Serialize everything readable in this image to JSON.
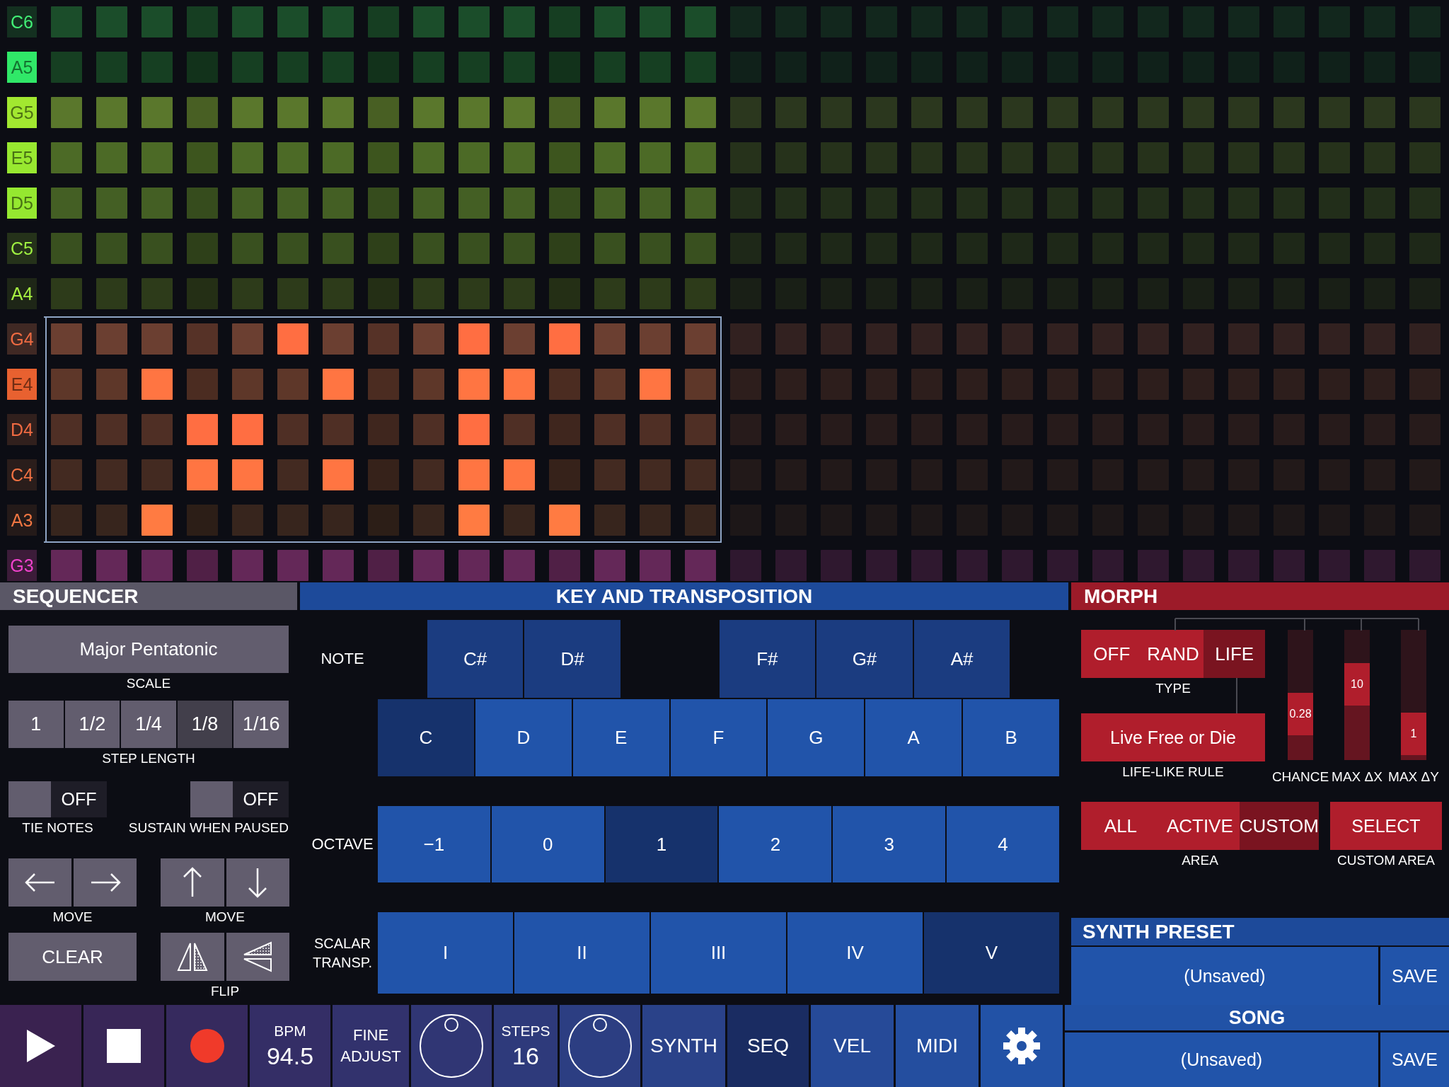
{
  "grid": {
    "rows": [
      {
        "label": "C6",
        "color": "#1b4d2a",
        "lit": false,
        "selected": false,
        "on": [
          false,
          false,
          false,
          false,
          false,
          false,
          false,
          false,
          false,
          false,
          false,
          false,
          false,
          false,
          false
        ]
      },
      {
        "label": "A5",
        "color": "#163f22",
        "lit": true,
        "selected": false,
        "on": [
          false,
          false,
          false,
          false,
          false,
          false,
          false,
          false,
          false,
          false,
          false,
          false,
          false,
          false,
          false
        ]
      },
      {
        "label": "G5",
        "color": "#5a772c",
        "lit": true,
        "selected": false,
        "on": [
          false,
          false,
          false,
          false,
          false,
          false,
          false,
          false,
          false,
          false,
          false,
          false,
          false,
          false,
          false
        ]
      },
      {
        "label": "E5",
        "color": "#4c6a26",
        "lit": true,
        "selected": false,
        "on": [
          false,
          false,
          false,
          false,
          false,
          false,
          false,
          false,
          false,
          false,
          false,
          false,
          false,
          false,
          false
        ]
      },
      {
        "label": "D5",
        "color": "#445f24",
        "lit": true,
        "selected": false,
        "on": [
          false,
          false,
          false,
          false,
          false,
          false,
          false,
          false,
          false,
          false,
          false,
          false,
          false,
          false,
          false
        ]
      },
      {
        "label": "C5",
        "color": "#39501f",
        "lit": false,
        "selected": false,
        "on": [
          false,
          false,
          false,
          false,
          false,
          false,
          false,
          false,
          false,
          false,
          false,
          false,
          false,
          false,
          false
        ]
      },
      {
        "label": "A4",
        "color": "#2d3b1a",
        "lit": false,
        "selected": false,
        "on": [
          false,
          false,
          false,
          false,
          false,
          false,
          false,
          false,
          false,
          false,
          false,
          false,
          false,
          false,
          false
        ]
      },
      {
        "label": "G4",
        "color": "#6b3f31",
        "lit": false,
        "selected": true,
        "on": [
          false,
          false,
          false,
          false,
          false,
          true,
          false,
          false,
          false,
          true,
          false,
          true,
          false,
          false,
          false
        ]
      },
      {
        "label": "E4",
        "color": "#5e3729",
        "lit": true,
        "selected": true,
        "on": [
          false,
          false,
          true,
          false,
          false,
          false,
          true,
          false,
          false,
          true,
          true,
          false,
          false,
          true,
          false
        ]
      },
      {
        "label": "D4",
        "color": "#4f2f25",
        "lit": false,
        "selected": true,
        "on": [
          false,
          false,
          false,
          true,
          true,
          false,
          false,
          false,
          false,
          true,
          false,
          false,
          false,
          false,
          false
        ]
      },
      {
        "label": "C4",
        "color": "#432a21",
        "lit": false,
        "selected": true,
        "on": [
          false,
          false,
          false,
          true,
          true,
          false,
          true,
          false,
          false,
          true,
          true,
          false,
          false,
          false,
          false
        ]
      },
      {
        "label": "A3",
        "color": "#37251d",
        "lit": false,
        "selected": true,
        "on": [
          false,
          false,
          true,
          false,
          false,
          false,
          false,
          false,
          false,
          true,
          false,
          true,
          false,
          false,
          false
        ]
      },
      {
        "label": "G3",
        "color": "#642858",
        "lit": false,
        "selected": false,
        "on": [
          false,
          false,
          false,
          false,
          false,
          false,
          false,
          false,
          false,
          false,
          false,
          false,
          false,
          false,
          false
        ]
      }
    ]
  },
  "sequencer": {
    "title": "SEQUENCER",
    "scale": {
      "value": "Major Pentatonic",
      "label": "SCALE"
    },
    "step_length": {
      "label": "STEP LENGTH",
      "options": [
        {
          "label": "1",
          "selected": false
        },
        {
          "label": "1/2",
          "selected": false
        },
        {
          "label": "1/4",
          "selected": false
        },
        {
          "label": "1/8",
          "selected": true
        },
        {
          "label": "1/16",
          "selected": false
        }
      ]
    },
    "toggles": [
      {
        "state": "OFF",
        "on": false,
        "label": "TIE NOTES"
      },
      {
        "state": "OFF",
        "on": false,
        "label": "SUSTAIN WHEN PAUSED"
      }
    ],
    "move_groups": [
      {
        "label": "MOVE",
        "buttons": [
          {
            "kind": "left"
          },
          {
            "kind": "right"
          }
        ]
      },
      {
        "label": "MOVE",
        "buttons": [
          {
            "kind": "up"
          },
          {
            "kind": "down"
          }
        ]
      }
    ],
    "clear": "CLEAR",
    "flip": {
      "label": "FLIP",
      "buttons": [
        {
          "kind": "horizontal"
        },
        {
          "kind": "vertical"
        }
      ]
    }
  },
  "key": {
    "title": "KEY AND TRANSPOSITION",
    "note_label": "NOTE",
    "notes": [
      {
        "label": "C",
        "selected": true,
        "sharp": {
          "label": "C#",
          "selected": false
        }
      },
      {
        "label": "D",
        "selected": false,
        "sharp": {
          "label": "D#",
          "selected": false
        }
      },
      {
        "label": "E",
        "selected": false
      },
      {
        "label": "F",
        "selected": false,
        "sharp": {
          "label": "F#",
          "selected": false
        }
      },
      {
        "label": "G",
        "selected": false,
        "sharp": {
          "label": "G#",
          "selected": false
        }
      },
      {
        "label": "A",
        "selected": false,
        "sharp": {
          "label": "A#",
          "selected": false
        }
      },
      {
        "label": "B",
        "selected": false
      }
    ],
    "octave_label": "OCTAVE",
    "octaves": [
      {
        "label": "−1",
        "selected": false
      },
      {
        "label": "0",
        "selected": false
      },
      {
        "label": "1",
        "selected": true
      },
      {
        "label": "2",
        "selected": false
      },
      {
        "label": "3",
        "selected": false
      },
      {
        "label": "4",
        "selected": false
      }
    ],
    "transp_label": "SCALAR TRANSP.",
    "degrees": [
      {
        "label": "I",
        "selected": false
      },
      {
        "label": "II",
        "selected": false
      },
      {
        "label": "III",
        "selected": false
      },
      {
        "label": "IV",
        "selected": false
      },
      {
        "label": "V",
        "selected": true
      }
    ]
  },
  "morph": {
    "title": "MORPH",
    "type": {
      "label": "TYPE",
      "options": [
        {
          "label": "OFF",
          "selected": false
        },
        {
          "label": "RAND",
          "selected": false
        },
        {
          "label": "LIFE",
          "selected": true
        }
      ]
    },
    "rule": {
      "value": "Live Free or Die",
      "label": "LIFE-LIKE RULE"
    },
    "sliders": [
      {
        "label": "CHANCE",
        "reading": "0.28",
        "level": 0.19
      },
      {
        "label": "MAX ΔX",
        "reading": "10",
        "level": 0.42
      },
      {
        "label": "MAX ΔY",
        "reading": "1",
        "level": 0.04
      }
    ],
    "area": {
      "label": "AREA",
      "options": [
        {
          "label": "ALL",
          "selected": false
        },
        {
          "label": "ACTIVE",
          "selected": false
        },
        {
          "label": "CUSTOM",
          "selected": true
        }
      ]
    },
    "custom_area": {
      "button": "SELECT",
      "label": "CUSTOM AREA"
    }
  },
  "synth_preset": {
    "title": "SYNTH PRESET",
    "name": "(Unsaved)",
    "save": "SAVE"
  },
  "transport": [
    {
      "kind": "play"
    },
    {
      "kind": "stop"
    },
    {
      "kind": "record"
    }
  ],
  "bpm": {
    "label": "BPM",
    "value": "94.5"
  },
  "fine_adjust": "FINE ADJUST",
  "steps": {
    "label": "STEPS",
    "value": "16"
  },
  "tabs": [
    {
      "label": "SYNTH",
      "selected": false
    },
    {
      "label": "SEQ",
      "selected": true
    },
    {
      "label": "VEL",
      "selected": false
    },
    {
      "label": "MIDI",
      "selected": false
    }
  ],
  "song": {
    "title": "SONG",
    "name": "(Unsaved)",
    "save": "SAVE"
  }
}
